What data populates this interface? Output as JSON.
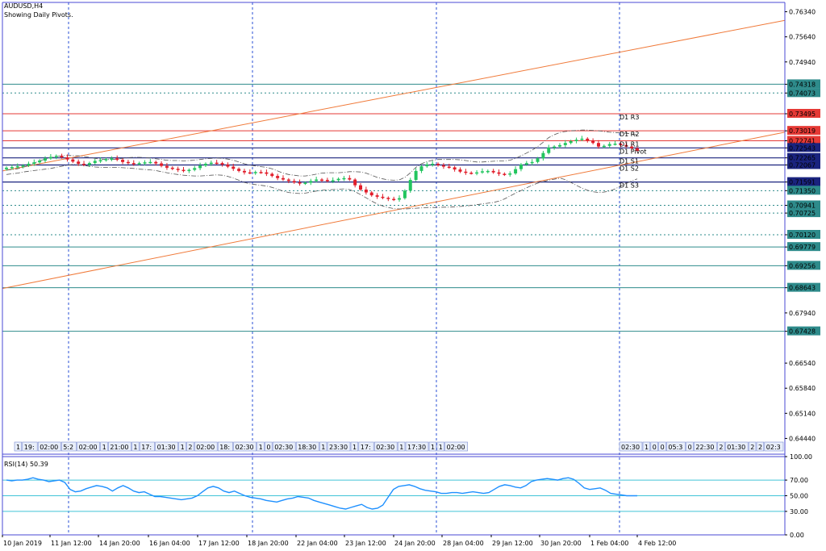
{
  "window": {
    "symbol_timeframe": "AUDUSD,H4",
    "indicator_note": "Showing Daily Pivots.",
    "rsi_label": "RSI(14) 50.39"
  },
  "colors": {
    "background": "#ffffff",
    "bull": "#22c55e",
    "bear": "#e11d2a",
    "resistance": "#e53935",
    "support": "#1a237e",
    "teal_level": "#2e8b8b",
    "channel": "#f07a3a",
    "grid_blue": "#2a4fd6",
    "rsi_line": "#1e90ff",
    "rsi_level": "#40c4d8",
    "axis": "#4a4ad6"
  },
  "chart_data": [
    {
      "type": "candlestick",
      "ylim": [
        0.64,
        0.766
      ],
      "y_ticks": [
        "0.76340",
        "0.75640",
        "0.74940",
        "0.74318",
        "0.74073",
        "0.73495",
        "0.73019",
        "0.72741",
        "0.72543",
        "0.72265",
        "0.72067",
        "0.71591",
        "0.71350",
        "0.70941",
        "0.70725",
        "0.70120",
        "0.69779",
        "0.69256",
        "0.68643",
        "0.67940",
        "0.67428",
        "0.66540",
        "0.65840",
        "0.65140",
        "0.64440"
      ],
      "x_ticks": [
        "10 Jan 2019",
        "11 Jan 12:00",
        "14 Jan 20:00",
        "16 Jan 04:00",
        "17 Jan 12:00",
        "18 Jan 20:00",
        "22 Jan 04:00",
        "23 Jan 12:00",
        "24 Jan 20:00",
        "28 Jan 04:00",
        "29 Jan 12:00",
        "30 Jan 20:00",
        "1 Feb 04:00",
        "4 Feb 12:00"
      ],
      "pivot_labels": [
        "D1 R3",
        "D1 R2",
        "D1 R1",
        "D1 Pivot",
        "D1 S1",
        "D1 S2",
        "D1 S3"
      ],
      "horizontal_levels": [
        {
          "price": 0.74318,
          "kind": "teal"
        },
        {
          "price": 0.74073,
          "kind": "dotted"
        },
        {
          "price": 0.73495,
          "kind": "resistance"
        },
        {
          "price": 0.73019,
          "kind": "resistance"
        },
        {
          "price": 0.72741,
          "kind": "resistance"
        },
        {
          "price": 0.72543,
          "kind": "support"
        },
        {
          "price": 0.72265,
          "kind": "support"
        },
        {
          "price": 0.72067,
          "kind": "support"
        },
        {
          "price": 0.71591,
          "kind": "support"
        },
        {
          "price": 0.7135,
          "kind": "dotted"
        },
        {
          "price": 0.70941,
          "kind": "dotted"
        },
        {
          "price": 0.70725,
          "kind": "dotted"
        },
        {
          "price": 0.7012,
          "kind": "dotted"
        },
        {
          "price": 0.69779,
          "kind": "teal"
        },
        {
          "price": 0.69256,
          "kind": "teal"
        },
        {
          "price": 0.68643,
          "kind": "teal"
        },
        {
          "price": 0.67428,
          "kind": "teal"
        }
      ],
      "channel": {
        "upper": [
          [
            0,
            0.719
          ],
          [
            155,
            0.761
          ]
        ],
        "lower": [
          [
            0,
            0.6862
          ],
          [
            155,
            0.7298
          ]
        ]
      },
      "close_series": [
        0.7199,
        0.7201,
        0.7203,
        0.7205,
        0.721,
        0.7214,
        0.7219,
        0.7225,
        0.7229,
        0.7232,
        0.7228,
        0.7222,
        0.7216,
        0.721,
        0.7207,
        0.7212,
        0.7218,
        0.722,
        0.7223,
        0.7225,
        0.7221,
        0.7215,
        0.7212,
        0.721,
        0.7212,
        0.7214,
        0.7215,
        0.7211,
        0.7204,
        0.7199,
        0.7196,
        0.7193,
        0.719,
        0.7193,
        0.7198,
        0.7205,
        0.721,
        0.7213,
        0.7212,
        0.7208,
        0.7202,
        0.7196,
        0.719,
        0.7186,
        0.7185,
        0.7187,
        0.7186,
        0.7182,
        0.7176,
        0.717,
        0.7166,
        0.7162,
        0.7158,
        0.7155,
        0.7157,
        0.7162,
        0.7166,
        0.7165,
        0.7162,
        0.7164,
        0.7168,
        0.717,
        0.7166,
        0.715,
        0.7138,
        0.713,
        0.7122,
        0.7118,
        0.7115,
        0.7112,
        0.711,
        0.7114,
        0.7135,
        0.7165,
        0.719,
        0.7203,
        0.7208,
        0.721,
        0.7206,
        0.7202,
        0.72,
        0.7194,
        0.7188,
        0.7185,
        0.7184,
        0.7186,
        0.7189,
        0.719,
        0.7186,
        0.7182,
        0.718,
        0.7183,
        0.7195,
        0.7208,
        0.7212,
        0.7215,
        0.7225,
        0.724,
        0.7255,
        0.7258,
        0.7262,
        0.7268,
        0.7273,
        0.7277,
        0.728,
        0.7275,
        0.7268,
        0.7258,
        0.726,
        0.7265,
        0.7266,
        0.7262,
        0.7258,
        0.7253,
        0.7246
      ],
      "upper_band": [
        0.7192,
        0.7194,
        0.7196,
        0.72,
        0.7205,
        0.7212,
        0.7218,
        0.7223,
        0.7227,
        0.723,
        0.7232,
        0.7233,
        0.7233,
        0.7232,
        0.723,
        0.7228,
        0.7225,
        0.7223,
        0.7222,
        0.7222,
        0.7223,
        0.7225,
        0.7227,
        0.7228,
        0.7228,
        0.7227,
        0.7226,
        0.7224,
        0.7222,
        0.722,
        0.7219,
        0.7219,
        0.7218,
        0.7219,
        0.722,
        0.7222,
        0.7224,
        0.7225,
        0.7226,
        0.7225,
        0.7223,
        0.722,
        0.7215,
        0.721,
        0.7206,
        0.7204,
        0.7202,
        0.72,
        0.7196,
        0.719,
        0.7184,
        0.718,
        0.7178,
        0.7176,
        0.7176,
        0.7178,
        0.7181,
        0.7184,
        0.7185,
        0.7185,
        0.7185,
        0.7186,
        0.7188,
        0.7188,
        0.7187,
        0.7184,
        0.7178,
        0.7172,
        0.7168,
        0.7165,
        0.7164,
        0.7165,
        0.7172,
        0.7185,
        0.72,
        0.721,
        0.7216,
        0.722,
        0.7222,
        0.7222,
        0.7222,
        0.7222,
        0.7221,
        0.7219,
        0.7217,
        0.7215,
        0.7215,
        0.7216,
        0.7217,
        0.7218,
        0.7218,
        0.722,
        0.7225,
        0.7232,
        0.724,
        0.7248,
        0.7258,
        0.727,
        0.7283,
        0.7291,
        0.7297,
        0.73,
        0.7302,
        0.7303,
        0.7304,
        0.7304,
        0.7303,
        0.7302,
        0.73,
        0.7298,
        0.7297,
        0.7296,
        0.7295,
        0.7293,
        0.7291
      ],
      "lower_band": [
        0.718,
        0.7182,
        0.7184,
        0.7187,
        0.7189,
        0.7191,
        0.7193,
        0.7195,
        0.7197,
        0.72,
        0.7203,
        0.7206,
        0.7208,
        0.7207,
        0.7205,
        0.7203,
        0.7201,
        0.72,
        0.72,
        0.72,
        0.72,
        0.7199,
        0.7198,
        0.7197,
        0.7195,
        0.7194,
        0.7193,
        0.7191,
        0.7188,
        0.7185,
        0.7182,
        0.718,
        0.7178,
        0.7177,
        0.7176,
        0.7176,
        0.7177,
        0.7178,
        0.7179,
        0.7178,
        0.7175,
        0.717,
        0.7164,
        0.7158,
        0.7154,
        0.7152,
        0.715,
        0.7148,
        0.7144,
        0.7139,
        0.7134,
        0.713,
        0.7128,
        0.7127,
        0.7128,
        0.7131,
        0.7134,
        0.7136,
        0.7137,
        0.7138,
        0.7139,
        0.714,
        0.7138,
        0.7132,
        0.7124,
        0.7115,
        0.7106,
        0.7098,
        0.7092,
        0.7088,
        0.7085,
        0.7084,
        0.7084,
        0.7085,
        0.7086,
        0.7087,
        0.7088,
        0.7088,
        0.7088,
        0.7089,
        0.7089,
        0.709,
        0.7091,
        0.7092,
        0.7094,
        0.7096,
        0.7098,
        0.71,
        0.7102,
        0.7106,
        0.7112,
        0.712,
        0.7128,
        0.7135,
        0.7143,
        0.715,
        0.7156,
        0.716,
        0.7164,
        0.7167,
        0.717,
        0.7166,
        0.7158,
        0.715,
        0.7142,
        0.7136,
        0.7132,
        0.713,
        0.7131,
        0.7134,
        0.714,
        0.7148,
        0.7155,
        0.7162,
        0.7168
      ]
    },
    {
      "type": "line",
      "title": "RSI(14) 50.39",
      "ylim": [
        0,
        100
      ],
      "y_ticks": [
        "100.00",
        "70.00",
        "50.00",
        "30.00",
        "0.00"
      ],
      "levels": [
        70,
        50,
        30
      ],
      "values": [
        70,
        69,
        70,
        70,
        71,
        73,
        71,
        70,
        68,
        69,
        70,
        67,
        58,
        55,
        56,
        59,
        61,
        63,
        62,
        60,
        56,
        60,
        63,
        60,
        56,
        54,
        55,
        52,
        49,
        49,
        48,
        47,
        46,
        45,
        46,
        47,
        50,
        55,
        60,
        62,
        60,
        56,
        54,
        56,
        53,
        50,
        48,
        47,
        46,
        44,
        43,
        42,
        44,
        46,
        47,
        49,
        48,
        47,
        44,
        42,
        40,
        38,
        36,
        34,
        33,
        35,
        37,
        39,
        35,
        33,
        34,
        38,
        48,
        58,
        62,
        63,
        64,
        62,
        59,
        57,
        56,
        55,
        53,
        53,
        54,
        54,
        53,
        54,
        55,
        54,
        53,
        54,
        58,
        62,
        64,
        63,
        61,
        60,
        63,
        68,
        70,
        71,
        72,
        71,
        70,
        72,
        73,
        71,
        66,
        60,
        58,
        59,
        60,
        57,
        53,
        52,
        51,
        50,
        50,
        50
      ]
    }
  ],
  "time_labels": {
    "left": [
      "1",
      "19:",
      "02:00",
      "5:2",
      "02:00",
      "1",
      "21:00",
      "1",
      "17:",
      "01:30",
      "1",
      "2",
      "02:00",
      "18:",
      "02:30",
      "1",
      "0",
      "02:30",
      "18:30",
      "1",
      "23:30",
      "1",
      "17:",
      "02:30",
      "1",
      "17:30",
      "1",
      "1",
      "02:00"
    ],
    "right": [
      "02:30",
      "1",
      "0",
      "0",
      "05:3",
      "0",
      "22:30",
      "2",
      "01:30",
      "2",
      "2",
      "02:3"
    ]
  }
}
